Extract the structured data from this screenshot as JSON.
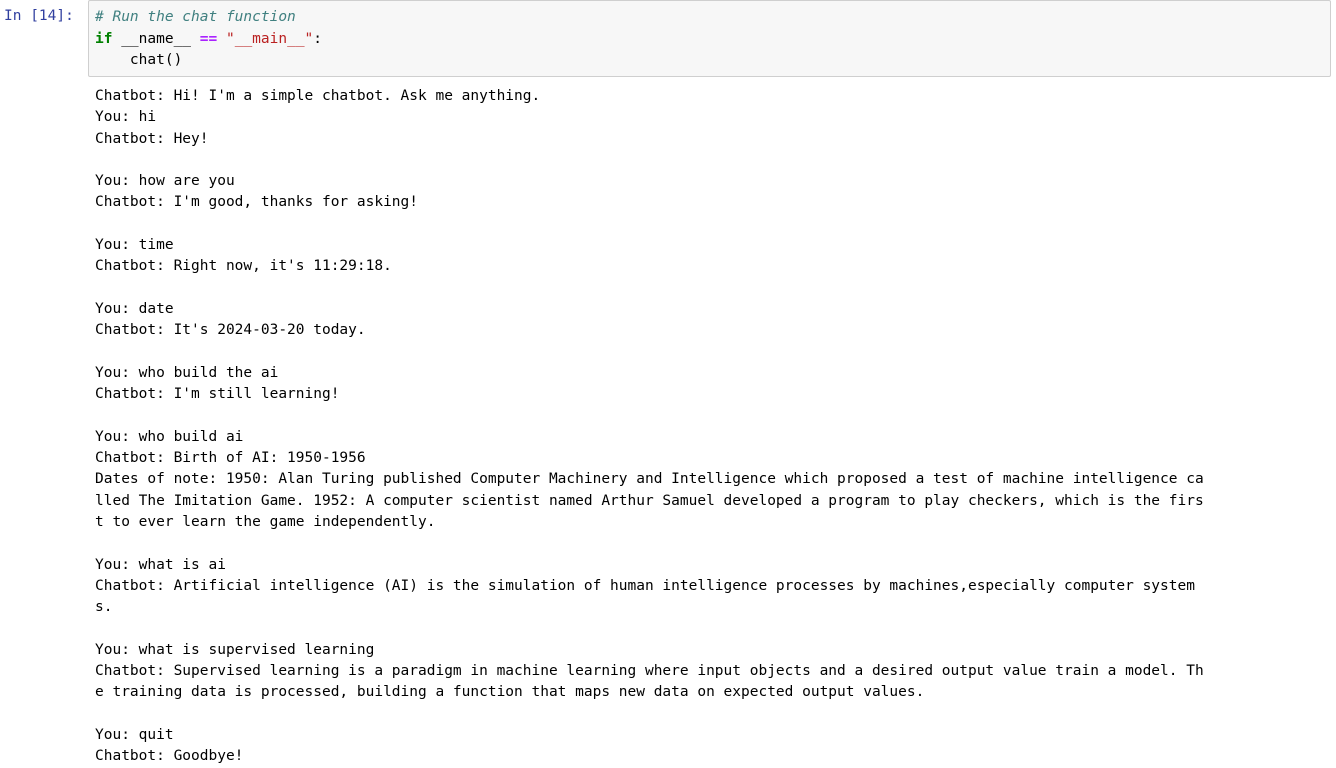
{
  "cell": {
    "prompt": "In [14]:",
    "code": {
      "comment": "# Run the chat function",
      "line2_kw": "if",
      "line2_name": " __name__ ",
      "line2_op": "==",
      "line2_space": " ",
      "line2_str": "\"__main__\"",
      "line2_colon": ":",
      "line3": "    chat()"
    }
  },
  "output_lines": [
    "Chatbot: Hi! I'm a simple chatbot. Ask me anything.",
    "You: hi",
    "Chatbot: Hey!",
    "",
    "You: how are you",
    "Chatbot: I'm good, thanks for asking!",
    "",
    "You: time",
    "Chatbot: Right now, it's 11:29:18.",
    "",
    "You: date",
    "Chatbot: It's 2024-03-20 today.",
    "",
    "You: who build the ai",
    "Chatbot: I'm still learning!",
    "",
    "You: who build ai",
    "Chatbot: Birth of AI: 1950-1956",
    "Dates of note: 1950: Alan Turing published Computer Machinery and Intelligence which proposed a test of machine intelligence ca",
    "lled The Imitation Game. 1952: A computer scientist named Arthur Samuel developed a program to play checkers, which is the firs",
    "t to ever learn the game independently.",
    "",
    "You: what is ai",
    "Chatbot: Artificial intelligence (AI) is the simulation of human intelligence processes by machines,especially computer system",
    "s.",
    "",
    "You: what is supervised learning",
    "Chatbot: Supervised learning is a paradigm in machine learning where input objects and a desired output value train a model. Th",
    "e training data is processed, building a function that maps new data on expected output values.",
    "",
    "You: quit",
    "Chatbot: Goodbye!"
  ]
}
